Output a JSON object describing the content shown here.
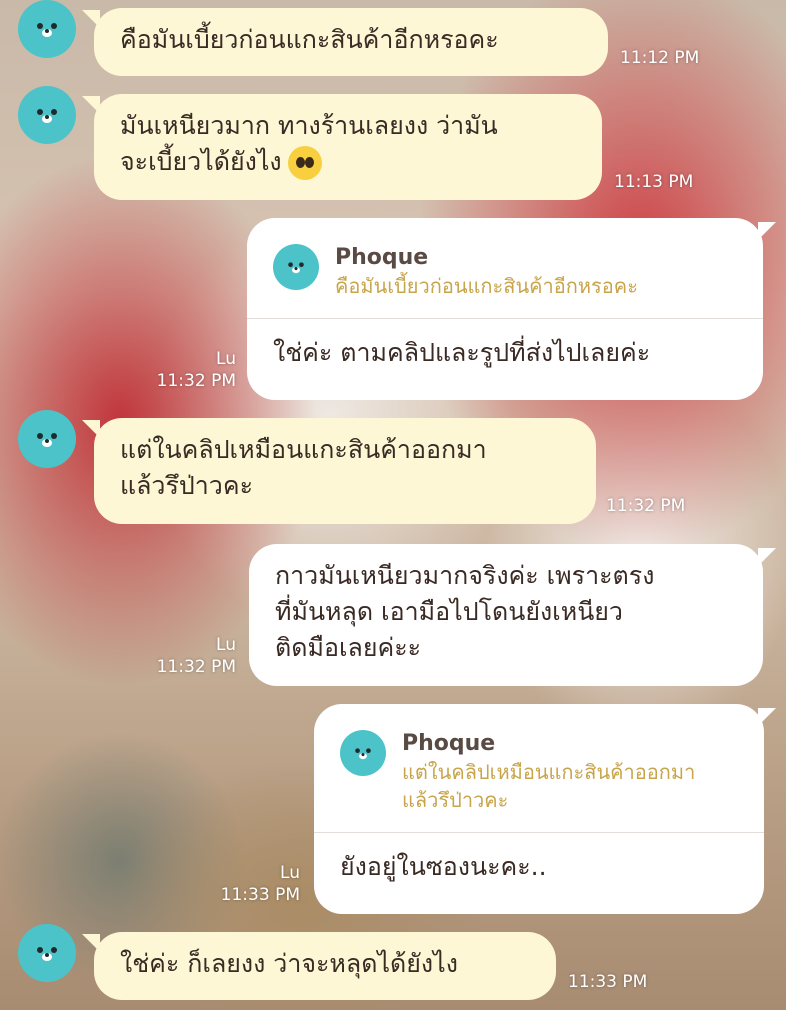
{
  "messages": [
    {
      "type": "incoming",
      "text": "คือมันเบี้ยวก่อนแกะสินค้าอีกหรอคะ",
      "time": "11:12 PM"
    },
    {
      "type": "incoming",
      "text_line1": "มันเหนียวมาก ทางร้านเลยงง ว่ามัน",
      "text_line2": "จะเบี้ยวได้ยังไง",
      "emoji": "pleading-face-emoji",
      "time": "11:13 PM"
    },
    {
      "type": "outgoing",
      "reply_name": "Phoque",
      "reply_quote": "คือมันเบี้ยวก่อนแกะสินค้าอีกหรอคะ",
      "text": "ใช่ค่ะ ตามคลิปและรูปที่ส่งไปเลยค่ะ",
      "read": "Lu",
      "time": "11:32 PM"
    },
    {
      "type": "incoming",
      "text_line1": "แต่ในคลิปเหมือนแกะสินค้าออกมา",
      "text_line2": "แล้วรึป่าวคะ",
      "time": "11:32 PM"
    },
    {
      "type": "outgoing",
      "text_line1": "กาวมันเหนียวมากจริงค่ะ เพราะตรง",
      "text_line2": "ที่มันหลุด เอามือไปโดนยังเหนียว",
      "text_line3": "ติดมือเลยค่ะะ",
      "read": "Lu",
      "time": "11:32 PM"
    },
    {
      "type": "outgoing",
      "reply_name": "Phoque",
      "reply_quote_line1": "แต่ในคลิปเหมือนแกะสินค้าออกมา",
      "reply_quote_line2": "แล้วรึป่าวคะ",
      "text": "ยังอยู่ในซองนะคะ..",
      "read": "Lu",
      "time": "11:33 PM"
    },
    {
      "type": "incoming",
      "text": "ใช่ค่ะ ก็เลยงง ว่าจะหลุดได้ยังไง",
      "time": "11:33 PM"
    }
  ],
  "avatar_icon": "seal-face-icon",
  "colors": {
    "incoming_bubble": "#fdf7d6",
    "outgoing_bubble": "#ffffff",
    "avatar": "#4cc3c9",
    "quote": "#c8a54a"
  }
}
